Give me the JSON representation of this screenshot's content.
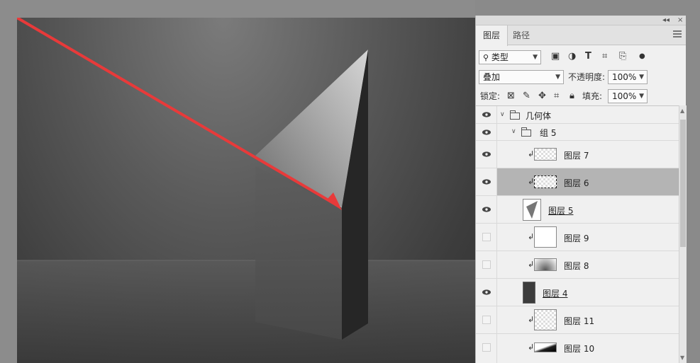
{
  "panel": {
    "topbar": {
      "collapse_label": "◂◂",
      "close_label": "×"
    },
    "tabs": [
      {
        "label": "图层",
        "active": true
      },
      {
        "label": "路径",
        "active": false
      }
    ],
    "filter": {
      "label": "类型",
      "icon": "search-icon"
    },
    "blend_mode": {
      "value": "叠加"
    },
    "opacity": {
      "label": "不透明度:",
      "value": "100%"
    },
    "lock": {
      "label": "锁定:"
    },
    "fill": {
      "label": "填充:",
      "value": "100%"
    }
  },
  "layers": [
    {
      "name": "几何体",
      "type": "group",
      "visible": true,
      "indent": 0
    },
    {
      "name": "组 5",
      "type": "group",
      "visible": true,
      "indent": 1
    },
    {
      "name": "图层 7",
      "type": "layer",
      "visible": true,
      "clipped": true,
      "thumb": "transparent"
    },
    {
      "name": "图层 6",
      "type": "layer",
      "visible": true,
      "clipped": true,
      "selected": true,
      "thumb": "transparent"
    },
    {
      "name": "图层 5",
      "type": "layer",
      "visible": true,
      "clipped": false,
      "thumb": "shape-gray"
    },
    {
      "name": "图层 9",
      "type": "layer",
      "visible": false,
      "clipped": true,
      "thumb": "white"
    },
    {
      "name": "图层 8",
      "type": "layer",
      "visible": false,
      "clipped": true,
      "thumb": "gradient"
    },
    {
      "name": "图层 4",
      "type": "layer",
      "visible": true,
      "clipped": false,
      "thumb": "dark"
    },
    {
      "name": "图层 11",
      "type": "layer",
      "visible": false,
      "clipped": true,
      "thumb": "transparent"
    },
    {
      "name": "图层 10",
      "type": "layer",
      "visible": false,
      "clipped": true,
      "thumb": "black-gradient"
    }
  ],
  "colors": {
    "arrow": "#e83a3a",
    "selected_row": "#b4b4b4",
    "panel_bg": "#f0f0f0"
  }
}
